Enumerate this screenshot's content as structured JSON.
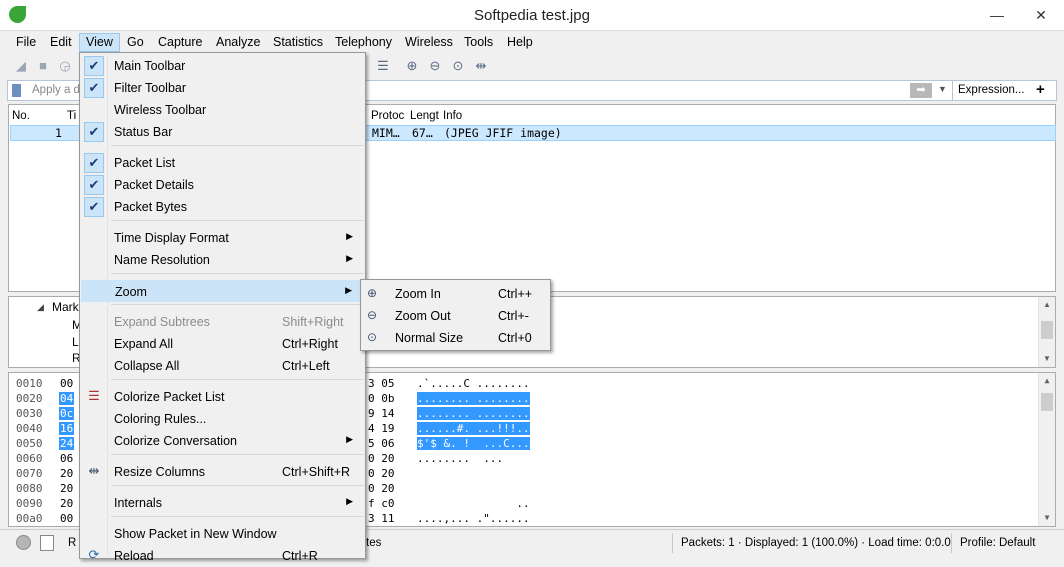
{
  "window": {
    "title": "Softpedia test.jpg",
    "minimize": "—",
    "maximize": "☐",
    "close": "✕"
  },
  "menubar": [
    "File",
    "Edit",
    "View",
    "Go",
    "Capture",
    "Analyze",
    "Statistics",
    "Telephony",
    "Wireless",
    "Tools",
    "Help"
  ],
  "filter": {
    "placeholder": "Apply a d",
    "expression_label": "Expression...",
    "add_label": "+"
  },
  "packet_list": {
    "columns": {
      "no": "No.",
      "time": "Ti",
      "protocol": "Protoc",
      "length": "Lengt",
      "info": "Info"
    },
    "rows": [
      {
        "no": "1",
        "protocol": "MIM…",
        "length": "67…",
        "info": "(JPEG JFIF image)"
      }
    ]
  },
  "details": {
    "lines": [
      "Mark",
      "M",
      "L",
      "R"
    ]
  },
  "bytes": {
    "offsets": [
      "0010",
      "0020",
      "0030",
      "0040",
      "0050",
      "0060",
      "0070",
      "0080",
      "0090",
      "00a0"
    ],
    "left_hex": [
      "00",
      "04",
      "0c",
      "16",
      "24",
      "06",
      "20",
      "20",
      "20",
      "00"
    ],
    "right_hex": [
      "3 05",
      "0 0b",
      "9 14",
      "4 19",
      "5 06",
      "0 20",
      "0 20",
      "0 20",
      "f c0",
      "3 11"
    ],
    "ascii": [
      ".`.....C ........",
      "........ ........",
      "........ ........",
      "......#. ...!!!..",
      "$'$ &. !  ...C...",
      "........  ...",
      "",
      "",
      "               ..",
      "....,... .\"......"
    ],
    "highlighted_rows": [
      1,
      2,
      3,
      4
    ]
  },
  "view_menu": {
    "items": [
      {
        "label": "Main Toolbar",
        "checked": true
      },
      {
        "label": "Filter Toolbar",
        "checked": true
      },
      {
        "label": "Wireless Toolbar",
        "checked": false
      },
      {
        "label": "Status Bar",
        "checked": true
      },
      {
        "label": "Packet List",
        "checked": true
      },
      {
        "label": "Packet Details",
        "checked": true
      },
      {
        "label": "Packet Bytes",
        "checked": true
      },
      {
        "label": "Time Display Format",
        "submenu": true
      },
      {
        "label": "Name Resolution",
        "submenu": true
      },
      {
        "label": "Zoom",
        "submenu": true,
        "highlighted": true
      },
      {
        "label": "Expand Subtrees",
        "shortcut": "Shift+Right",
        "disabled": true
      },
      {
        "label": "Expand All",
        "shortcut": "Ctrl+Right"
      },
      {
        "label": "Collapse All",
        "shortcut": "Ctrl+Left"
      },
      {
        "label": "Colorize Packet List"
      },
      {
        "label": "Coloring Rules..."
      },
      {
        "label": "Colorize Conversation",
        "submenu": true
      },
      {
        "label": "Resize Columns",
        "shortcut": "Ctrl+Shift+R"
      },
      {
        "label": "Internals",
        "submenu": true
      },
      {
        "label": "Show Packet in New Window"
      },
      {
        "label": "Reload",
        "shortcut": "Ctrl+R"
      }
    ]
  },
  "zoom_menu": {
    "items": [
      {
        "label": "Zoom In",
        "shortcut": "Ctrl++",
        "icon": "zoom-in-icon"
      },
      {
        "label": "Zoom Out",
        "shortcut": "Ctrl+-",
        "icon": "zoom-out-icon"
      },
      {
        "label": "Normal Size",
        "shortcut": "Ctrl+0",
        "icon": "zoom-reset-icon"
      }
    ]
  },
  "status": {
    "left_text": "R",
    "mid_text": "tes",
    "packets": "Packets: 1 · Displayed: 1 (100.0%) · Load time: 0:0.0",
    "profile": "Profile: Default"
  },
  "colors": {
    "selection": "#cce8ff",
    "menu_hover": "#cce4f7",
    "byte_highlight": "#3399ff"
  }
}
